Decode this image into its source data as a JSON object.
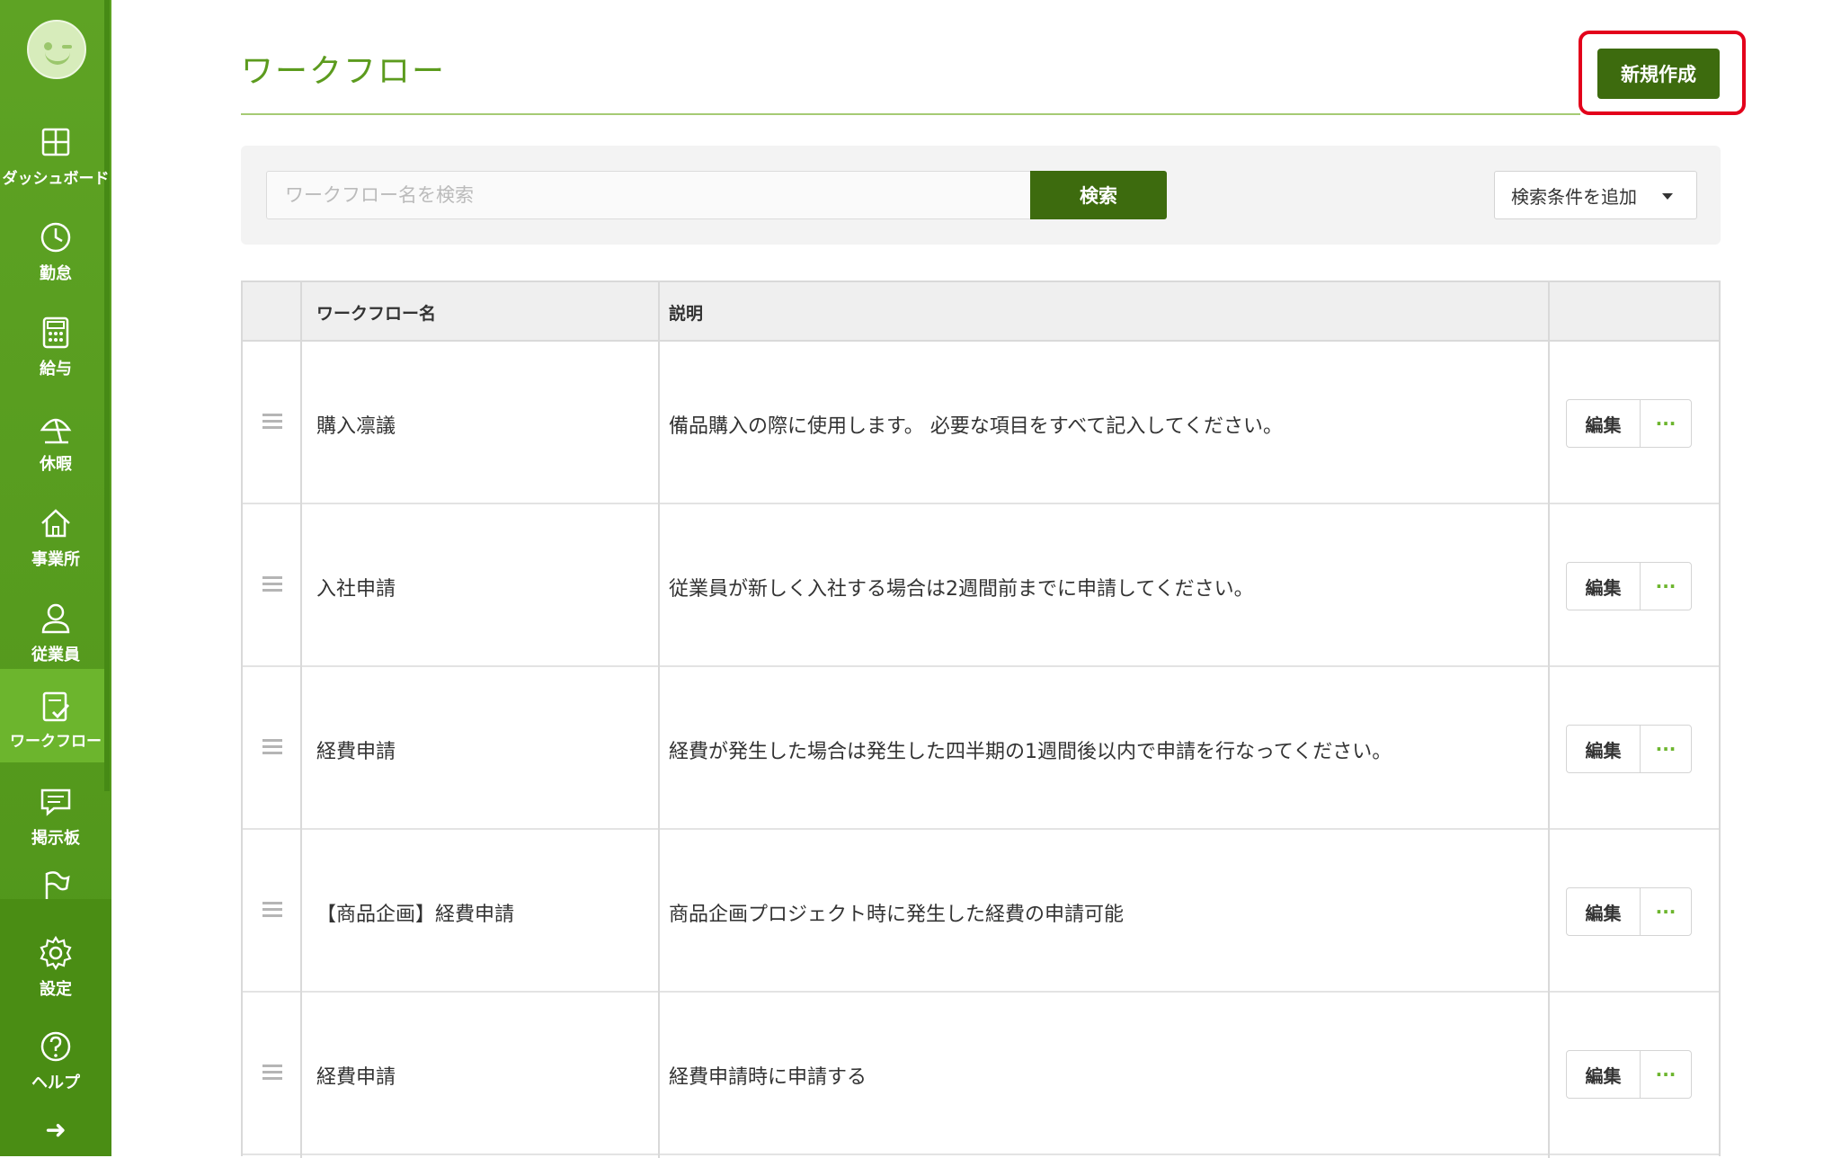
{
  "sidebar": {
    "items": [
      {
        "label": "ダッシュボード",
        "icon": "dashboard-icon"
      },
      {
        "label": "勤怠",
        "icon": "clock-icon"
      },
      {
        "label": "給与",
        "icon": "calculator-icon"
      },
      {
        "label": "休暇",
        "icon": "umbrella-icon"
      },
      {
        "label": "事業所",
        "icon": "home-icon"
      },
      {
        "label": "従業員",
        "icon": "person-icon"
      },
      {
        "label": "ワークフロー",
        "icon": "workflow-checklist-icon",
        "active": true
      },
      {
        "label": "掲示板",
        "icon": "chat-icon"
      },
      {
        "label": "",
        "icon": "flag-icon"
      },
      {
        "label": "設定",
        "icon": "gear-icon"
      },
      {
        "label": "ヘルプ",
        "icon": "question-icon"
      }
    ],
    "collapse_icon": "arrow-right-icon"
  },
  "header": {
    "title": "ワークフロー",
    "new_button": "新規作成"
  },
  "search": {
    "placeholder": "ワークフロー名を検索",
    "button": "検索",
    "filter_button": "検索条件を追加"
  },
  "table": {
    "columns": [
      "ワークフロー名",
      "説明",
      ""
    ],
    "rows": [
      {
        "name": "購入凛議",
        "description": "備品購入の際に使用します。 必要な項目をすべて記入してください。",
        "edit": "編集",
        "more": "···"
      },
      {
        "name": "入社申請",
        "description": "従業員が新しく入社する場合は2週間前までに申請してください。",
        "edit": "編集",
        "more": "···"
      },
      {
        "name": "経費申請",
        "description": "経費が発生した場合は発生した四半期の1週間後以内で申請を行なってください。",
        "edit": "編集",
        "more": "···"
      },
      {
        "name": "【商品企画】経費申請",
        "description": "商品企画プロジェクト時に発生した経費の申請可能",
        "edit": "編集",
        "more": "···"
      },
      {
        "name": "経費申請",
        "description": "経費申請時に申請する",
        "edit": "編集",
        "more": "···"
      }
    ]
  },
  "colors": {
    "sidebar": "#5ea324",
    "primary_button": "#3d6b0e",
    "title": "#5c9b1e",
    "highlight": "#e3001b"
  }
}
